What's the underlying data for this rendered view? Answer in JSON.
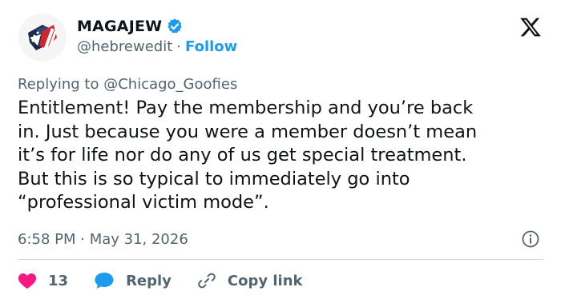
{
  "author": {
    "display_name": "MAGAJEW",
    "handle": "@hebrewedit",
    "follow_label": "Follow",
    "separator": "·"
  },
  "reply": {
    "prefix": "Replying to",
    "target": "@Chicago_Goofies"
  },
  "tweet": {
    "text": "Entitlement! Pay the membership and you’re back\nin. Just because you were a member doesn’t mean\nit’s for life nor do any of us get special treatment.\nBut this is so typical to immediately go into\n“professional victim mode”.",
    "timestamp": "6:58 PM · May 31, 2026"
  },
  "actions": {
    "like_count": "13",
    "reply_label": "Reply",
    "copy_link_label": "Copy link"
  },
  "colors": {
    "accent": "#1d9bf0",
    "like": "#f91880",
    "muted": "#536471"
  },
  "icons": [
    "x-logo-icon",
    "verified-badge-icon",
    "info-icon",
    "heart-icon",
    "reply-bubble-icon",
    "link-icon"
  ]
}
